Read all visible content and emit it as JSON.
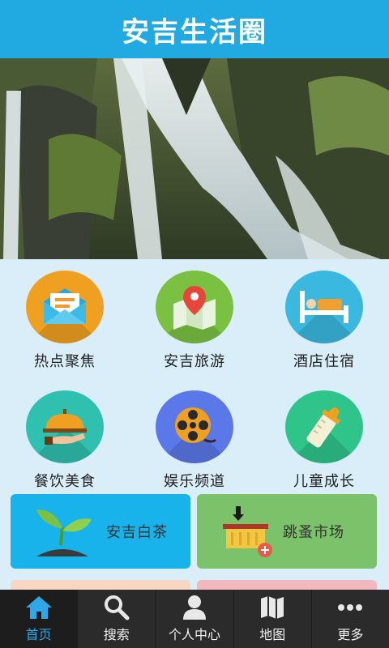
{
  "header": {
    "title": "安吉生活圈"
  },
  "banner": {
    "slides": 5,
    "active_index": 0
  },
  "grid": [
    {
      "label": "热点聚焦",
      "icon": "envelope-icon",
      "color": "#f0a020"
    },
    {
      "label": "安吉旅游",
      "icon": "map-pin-icon",
      "color": "#7ac142"
    },
    {
      "label": "酒店住宿",
      "icon": "bed-icon",
      "color": "#3bb8e0"
    },
    {
      "label": "餐饮美食",
      "icon": "food-cloche-icon",
      "color": "#2fc0b0"
    },
    {
      "label": "娱乐频道",
      "icon": "film-reel-icon",
      "color": "#5a78e8"
    },
    {
      "label": "儿童成长",
      "icon": "baby-bottle-icon",
      "color": "#2ec48a"
    }
  ],
  "tiles": [
    {
      "label": "安吉白茶",
      "icon": "sprout-icon",
      "color": "#17b3ea"
    },
    {
      "label": "跳蚤市场",
      "icon": "basket-icon",
      "color": "#7cc26a"
    }
  ],
  "tabbar": [
    {
      "label": "首页",
      "icon": "home-icon",
      "active": true
    },
    {
      "label": "搜索",
      "icon": "search-icon",
      "active": false
    },
    {
      "label": "个人中心",
      "icon": "user-icon",
      "active": false
    },
    {
      "label": "地图",
      "icon": "map-icon",
      "active": false
    },
    {
      "label": "更多",
      "icon": "more-icon",
      "active": false
    }
  ]
}
